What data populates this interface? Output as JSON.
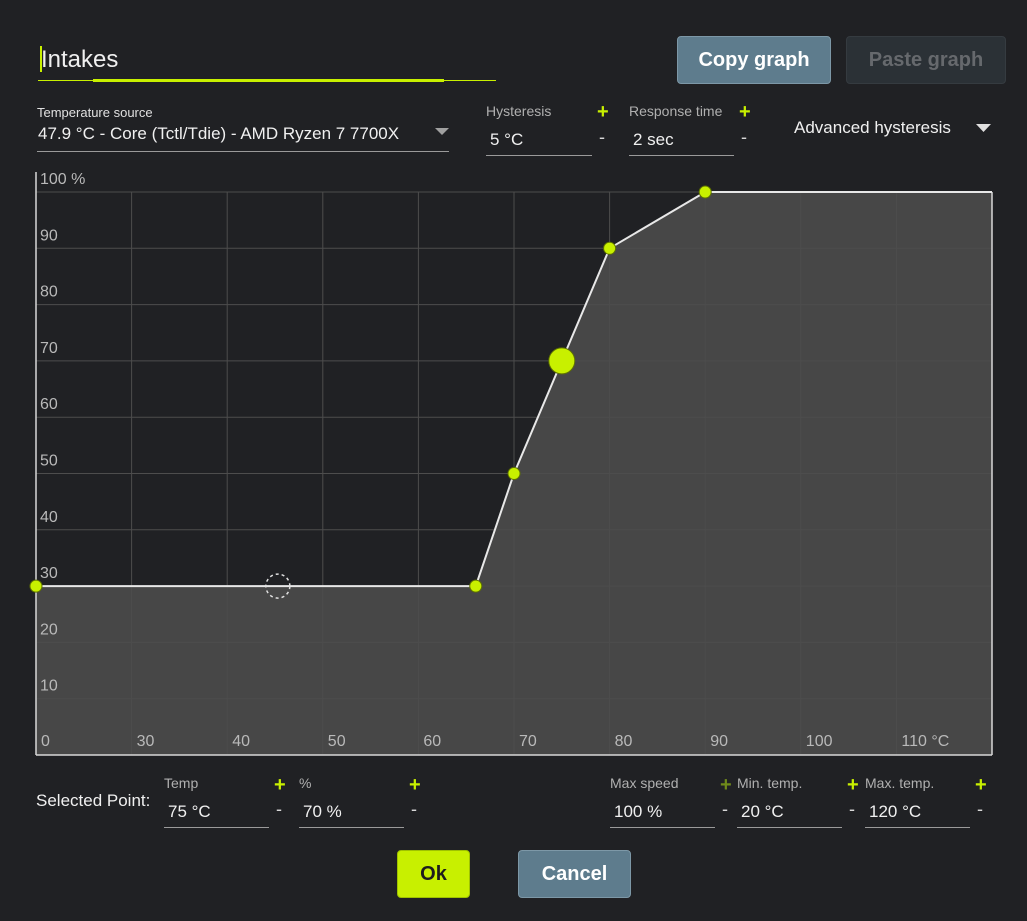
{
  "header": {
    "title_value": "Intakes",
    "copy_label": "Copy graph",
    "paste_label": "Paste graph"
  },
  "settings": {
    "temp_source_label": "Temperature source",
    "temp_source_value": "47.9 °C - Core (Tctl/Tdie) - AMD Ryzen 7 7700X",
    "hysteresis_label": "Hysteresis",
    "hysteresis_value": "5 °C",
    "response_label": "Response time",
    "response_value": "2 sec",
    "advanced_label": "Advanced hysteresis",
    "plus": "+",
    "minus": "-"
  },
  "chart_data": {
    "type": "line",
    "x_ticks": [
      "0",
      "30",
      "40",
      "50",
      "60",
      "70",
      "80",
      "90",
      "100",
      "110 °C"
    ],
    "y_ticks": [
      "100 %",
      "90",
      "80",
      "70",
      "60",
      "50",
      "40",
      "30",
      "20",
      "10"
    ],
    "points": [
      [
        20,
        30
      ],
      [
        66,
        30
      ],
      [
        70,
        50
      ],
      [
        80,
        90
      ],
      [
        90,
        100
      ],
      [
        120,
        100
      ]
    ],
    "selected_point": [
      75,
      70
    ],
    "current_marker": [
      45.3,
      30
    ],
    "xlim": [
      20,
      120
    ],
    "ylim": [
      0,
      100
    ],
    "accent": "#c8f000"
  },
  "selected": {
    "label": "Selected Point:",
    "temp_label": "Temp",
    "temp_value": "75 °C",
    "pct_label": "%",
    "pct_value": "70 %",
    "maxspeed_label": "Max speed",
    "maxspeed_value": "100 %",
    "mintemp_label": "Min. temp.",
    "mintemp_value": "20 °C",
    "maxtemp_label": "Max. temp.",
    "maxtemp_value": "120 °C"
  },
  "footer": {
    "ok_label": "Ok",
    "cancel_label": "Cancel"
  }
}
